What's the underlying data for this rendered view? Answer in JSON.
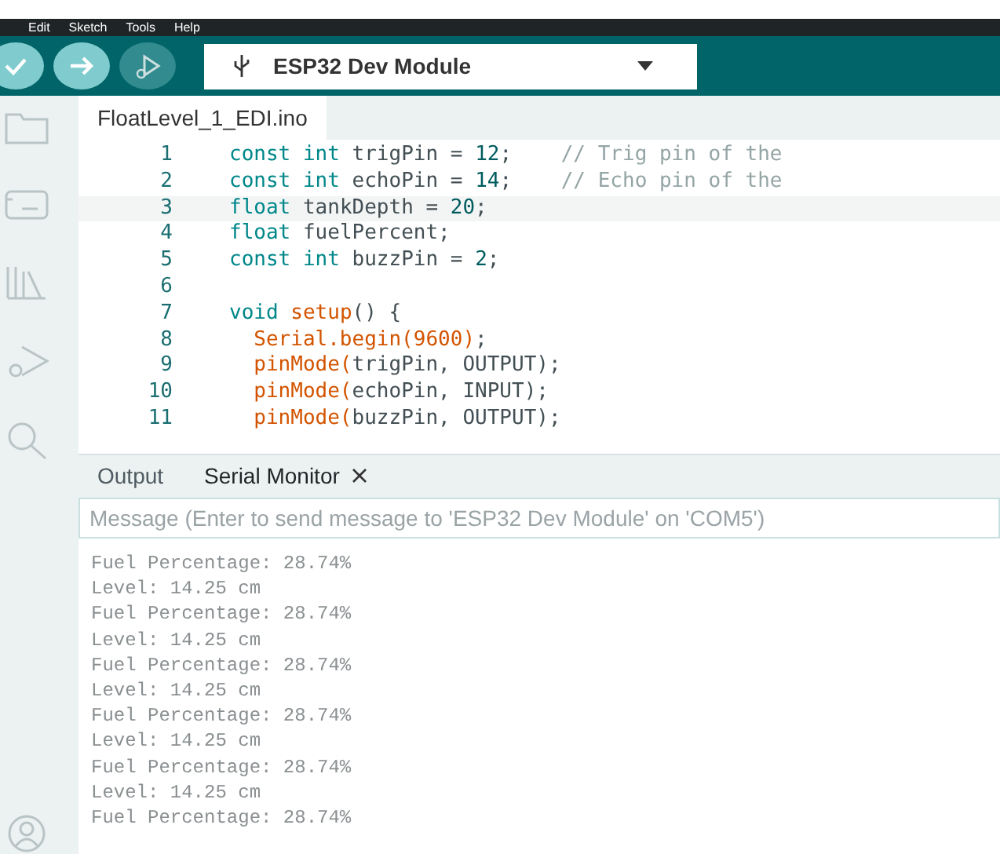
{
  "menu_bar": {
    "items": [
      "Edit",
      "Sketch",
      "Tools",
      "Help"
    ]
  },
  "toolbar": {
    "buttons": [
      {
        "kind": "verify",
        "disabled": false
      },
      {
        "kind": "upload",
        "disabled": false
      },
      {
        "kind": "debug",
        "disabled": true
      }
    ],
    "board_selector": {
      "label": "ESP32 Dev Module"
    }
  },
  "sidebar": {
    "items": [
      {
        "kind": "folder"
      },
      {
        "kind": "board"
      },
      {
        "kind": "library"
      },
      {
        "kind": "debug"
      },
      {
        "kind": "search"
      }
    ],
    "bottom": [
      {
        "kind": "account"
      }
    ]
  },
  "editor": {
    "tabs": [
      {
        "label": "FloatLevel_1_EDI.ino",
        "selected": true
      }
    ],
    "lines": [
      {
        "number": "1",
        "current": false,
        "indented": false,
        "tokens": [
          {
            "t": "const ",
            "color": "#00878a"
          },
          {
            "t": "int ",
            "color": "#00878a"
          },
          {
            "t": "trigPin = ",
            "color": "#434f54"
          },
          {
            "t": "12",
            "color": "#005c5f"
          },
          {
            "t": ";    ",
            "color": "#434f54"
          },
          {
            "t": "// Trig pin of the",
            "color": "#95a5a6"
          }
        ]
      },
      {
        "number": "2",
        "current": false,
        "indented": false,
        "tokens": [
          {
            "t": "const ",
            "color": "#00878a"
          },
          {
            "t": "int ",
            "color": "#00878a"
          },
          {
            "t": "echoPin = ",
            "color": "#434f54"
          },
          {
            "t": "14",
            "color": "#005c5f"
          },
          {
            "t": ";    ",
            "color": "#434f54"
          },
          {
            "t": "// Echo pin of the",
            "color": "#95a5a6"
          }
        ]
      },
      {
        "number": "3",
        "current": true,
        "indented": false,
        "tokens": [
          {
            "t": "float ",
            "color": "#00878a"
          },
          {
            "t": "tankDepth = ",
            "color": "#434f54"
          },
          {
            "t": "20",
            "color": "#005c5f"
          },
          {
            "t": ";",
            "color": "#434f54"
          }
        ]
      },
      {
        "number": "4",
        "current": false,
        "indented": false,
        "tokens": [
          {
            "t": "float ",
            "color": "#00878a"
          },
          {
            "t": "fuelPercent;",
            "color": "#434f54"
          }
        ]
      },
      {
        "number": "5",
        "current": false,
        "indented": false,
        "tokens": [
          {
            "t": "const ",
            "color": "#00878a"
          },
          {
            "t": "int ",
            "color": "#00878a"
          },
          {
            "t": "buzzPin = ",
            "color": "#434f54"
          },
          {
            "t": "2",
            "color": "#005c5f"
          },
          {
            "t": ";",
            "color": "#434f54"
          }
        ]
      },
      {
        "number": "6",
        "current": false
      },
      {
        "number": "7",
        "current": false,
        "indented": false,
        "tokens": [
          {
            "t": "void ",
            "color": "#00878a"
          },
          {
            "t": "setup",
            "color": "#d35400"
          },
          {
            "t": "() {",
            "color": "#434f54"
          }
        ]
      },
      {
        "number": "8",
        "current": false,
        "indented": true,
        "tokens": [
          {
            "t": "Serial.begin(9600)",
            "color": "#d35400"
          },
          {
            "t": ";",
            "color": "#434f54"
          }
        ]
      },
      {
        "number": "9",
        "current": false,
        "indented": true,
        "tokens": [
          {
            "t": "pinMode(",
            "color": "#d35400"
          },
          {
            "t": "trigPin, OUTPUT);",
            "color": "#434f54"
          }
        ]
      },
      {
        "number": "10",
        "current": false,
        "indented": true,
        "tokens": [
          {
            "t": "pinMode(",
            "color": "#d35400"
          },
          {
            "t": "echoPin, INPUT);",
            "color": "#434f54"
          }
        ]
      },
      {
        "number": "11",
        "current": false,
        "indented": true,
        "tokens": [
          {
            "t": "pinMode(",
            "color": "#d35400"
          },
          {
            "t": "buzzPin, OUTPUT);",
            "color": "#434f54"
          }
        ]
      }
    ]
  },
  "panel": {
    "tabs": [
      {
        "label": "Output",
        "selected": false,
        "closable": false
      },
      {
        "label": "Serial Monitor",
        "selected": true,
        "closable": true
      }
    ],
    "message_field": {
      "placeholder": "Message (Enter to send message to 'ESP32 Dev Module' on 'COM5')"
    },
    "output_lines": [
      "Fuel Percentage: 28.74%",
      "Level: 14.25 cm",
      "Fuel Percentage: 28.74%",
      "Level: 14.25 cm",
      "Fuel Percentage: 28.74%",
      "Level: 14.25 cm",
      "Fuel Percentage: 28.74%",
      "Level: 14.25 cm",
      "Fuel Percentage: 28.74%",
      "Level: 14.25 cm",
      "Fuel Percentage: 28.74%"
    ]
  }
}
